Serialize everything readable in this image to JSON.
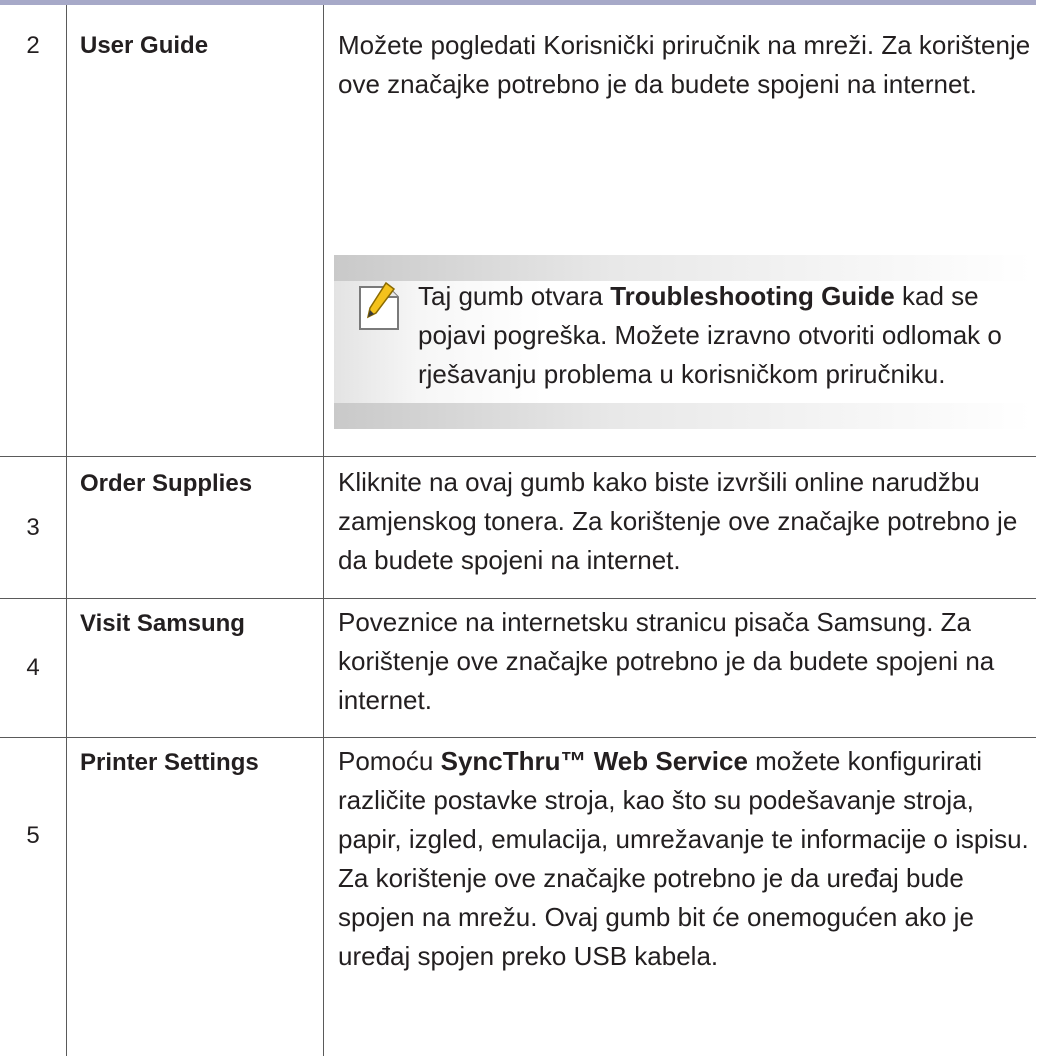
{
  "rows": [
    {
      "number": "2",
      "feature": "User Guide",
      "description": "Možete pogledati Korisnički priručnik na mreži. Za korištenje ove značajke potrebno je da budete spojeni na internet.",
      "note": {
        "icon": "note-pencil-icon",
        "text_before": "Taj gumb otvara ",
        "bold": "Troubleshooting Guide",
        "text_after": " kad se pojavi pogreška. Možete izravno otvoriti odlomak o rješavanju problema u korisničkom priručniku."
      }
    },
    {
      "number": "3",
      "feature": "Order Supplies",
      "description": "Kliknite na ovaj gumb kako biste izvršili online narudžbu zamjenskog tonera. Za korištenje ove značajke potrebno je da budete spojeni na internet."
    },
    {
      "number": "4",
      "feature": "Visit Samsung",
      "description": "Poveznice na internetsku stranicu pisača Samsung. Za korištenje ove značajke potrebno je da budete spojeni na internet."
    },
    {
      "number": "5",
      "feature": "Printer Settings",
      "description_before": "Pomoću ",
      "description_bold": "SyncThru™ Web Service",
      "description_after": " možete konfigurirati različite postavke stroja, kao što su podešavanje stroja, papir, izgled, emulacija, umrežavanje te informacije o ispisu. Za korištenje ove značajke potrebno je da uređaj bude spojen na mrežu. Ovaj gumb bit će onemogućen ako je uređaj spojen preko USB kabela."
    }
  ],
  "colors": {
    "header_bar": "#a7a9c8",
    "rule": "#5a5a5a",
    "text": "#231f20"
  }
}
